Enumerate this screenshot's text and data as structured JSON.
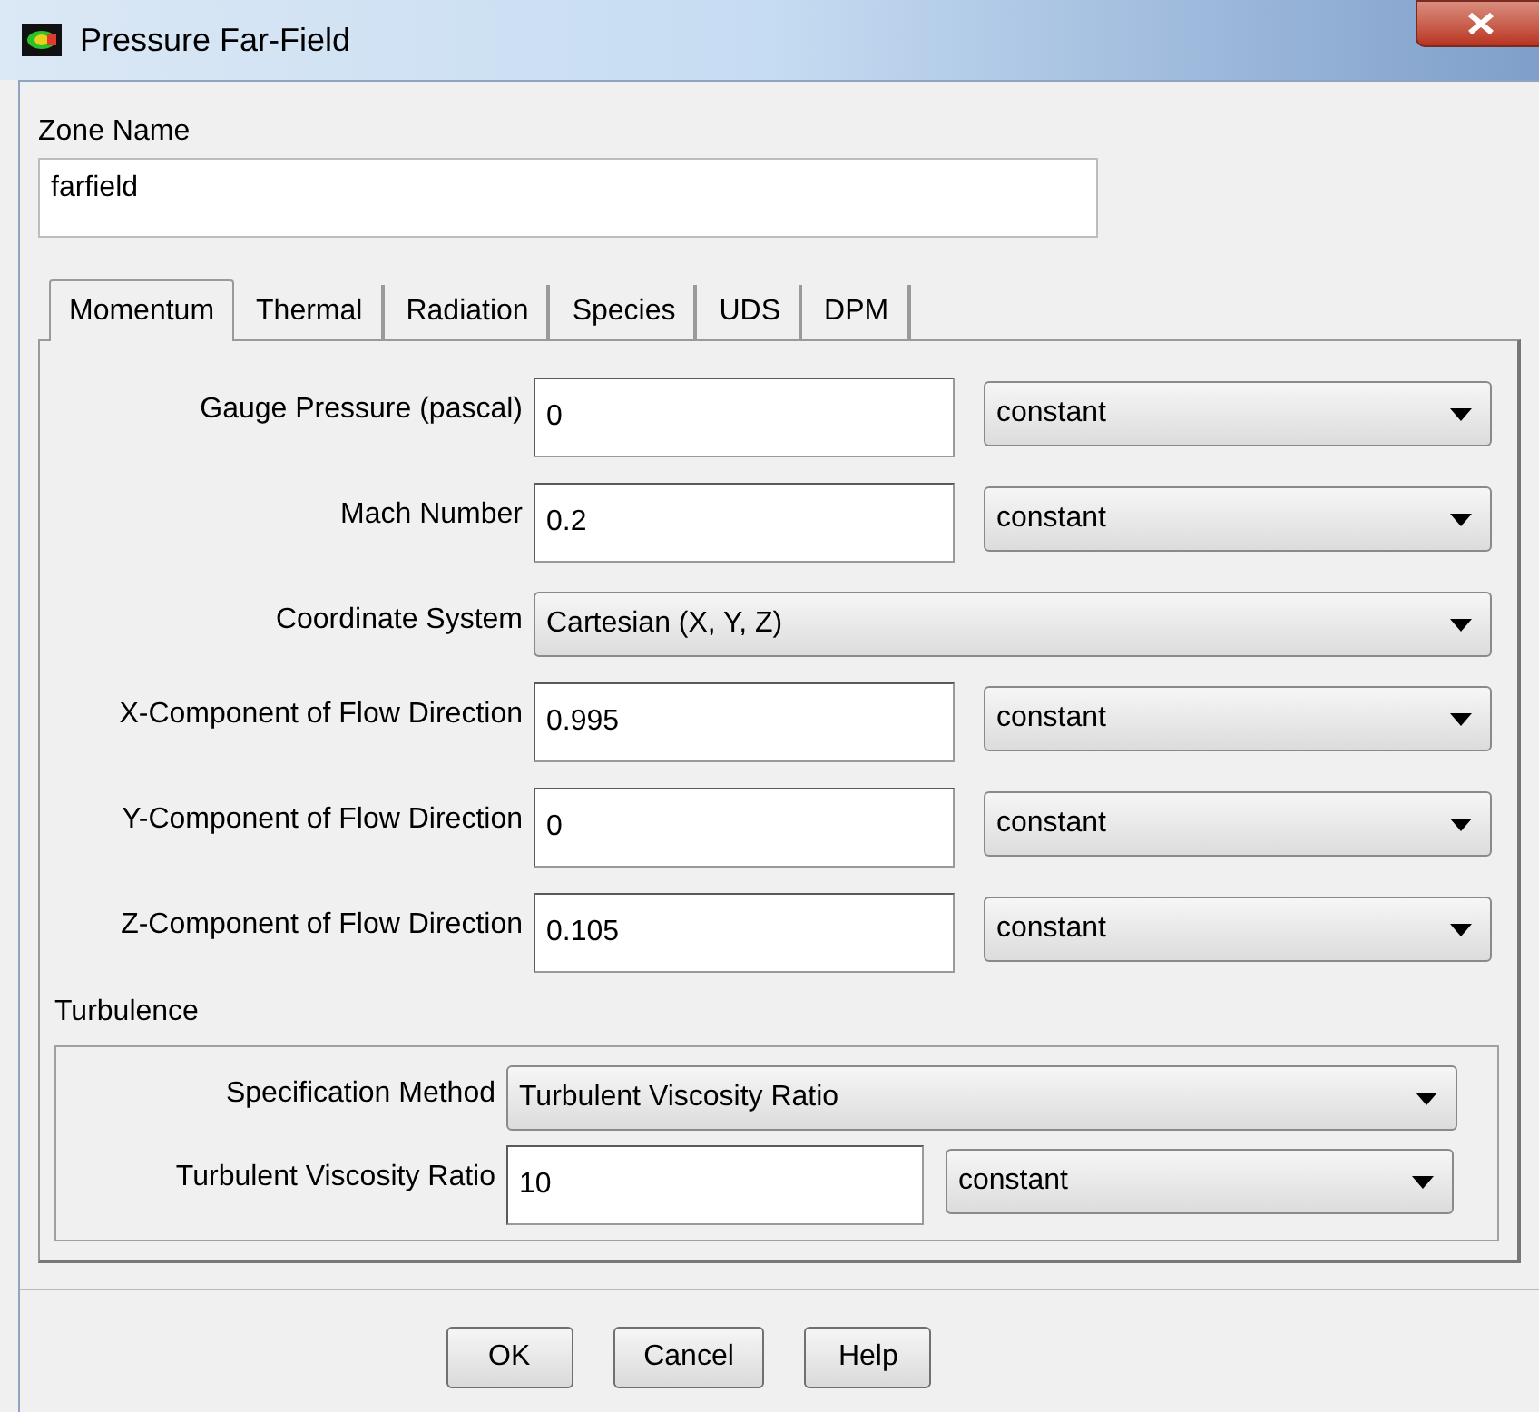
{
  "window": {
    "title": "Pressure Far-Field"
  },
  "zone_name": {
    "label": "Zone Name",
    "value": "farfield"
  },
  "tabs": [
    {
      "label": "Momentum",
      "selected": true
    },
    {
      "label": "Thermal",
      "selected": false
    },
    {
      "label": "Radiation",
      "selected": false
    },
    {
      "label": "Species",
      "selected": false
    },
    {
      "label": "UDS",
      "selected": false
    },
    {
      "label": "DPM",
      "selected": false
    }
  ],
  "momentum_rows": [
    {
      "kind": "field",
      "label": "Gauge Pressure (pascal)",
      "value": "0",
      "option": "constant"
    },
    {
      "kind": "field",
      "label": "Mach Number",
      "value": "0.2",
      "option": "constant"
    },
    {
      "kind": "select",
      "label": "Coordinate System",
      "option": "Cartesian (X, Y, Z)"
    },
    {
      "kind": "field",
      "label": "X-Component of Flow Direction",
      "value": "0.995",
      "option": "constant"
    },
    {
      "kind": "field",
      "label": "Y-Component of Flow Direction",
      "value": "0",
      "option": "constant"
    },
    {
      "kind": "field",
      "label": "Z-Component of Flow Direction",
      "value": "0.105",
      "option": "constant"
    }
  ],
  "turbulence": {
    "title": "Turbulence",
    "rows": [
      {
        "kind": "select",
        "label": "Specification Method",
        "option": "Turbulent Viscosity Ratio"
      },
      {
        "kind": "field",
        "label": "Turbulent Viscosity Ratio",
        "value": "10",
        "option": "constant"
      }
    ]
  },
  "buttons": [
    "OK",
    "Cancel",
    "Help"
  ]
}
